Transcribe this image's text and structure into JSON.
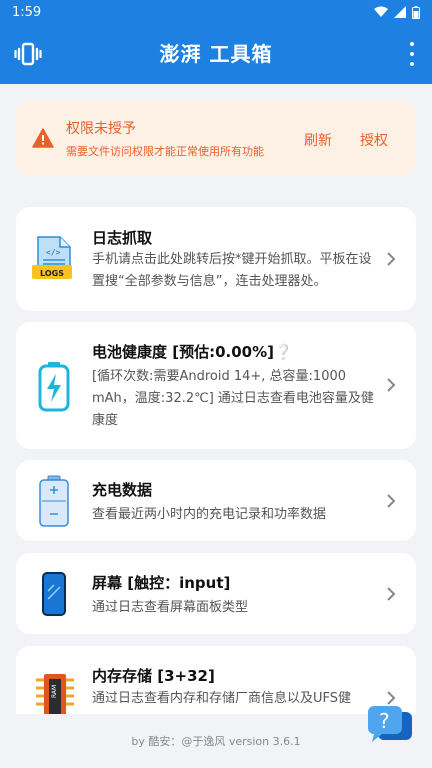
{
  "status": {
    "time": "1:59"
  },
  "app": {
    "title": "澎湃 工具箱"
  },
  "permission": {
    "title": "权限未授予",
    "description": "需要文件访问权限才能正常使用所有功能",
    "refresh_label": "刷新",
    "grant_label": "授权"
  },
  "cards": [
    {
      "title": "日志抓取",
      "description": "手机请点击此处跳转后按*键开始抓取。平板在设置搜“全部参数与信息”，连击处理器处。",
      "icon_badge": "LOGS"
    },
    {
      "title": "电池健康度 [预估:0.00%]❔",
      "description": "[循环次数:需要Android 14+, 总容量:1000 mAh，温度:32.2℃] 通过日志查看电池容量及健康度"
    },
    {
      "title": "充电数据",
      "description": "查看最近两小时内的充电记录和功率数据"
    },
    {
      "title": "屏幕 [触控：input]",
      "description": "通过日志查看屏幕面板类型"
    },
    {
      "title": "内存存储 [3+32]",
      "description": "通过日志查看内存和存储厂商信息以及UFS健",
      "icon_badge": "RAM"
    }
  ],
  "footer": {
    "credit": "by 酷安：@于逸风 version 3.6.1"
  },
  "colors": {
    "primary": "#1e80e0",
    "warning": "#e8612c",
    "warning_bg": "#fdf0e4"
  }
}
